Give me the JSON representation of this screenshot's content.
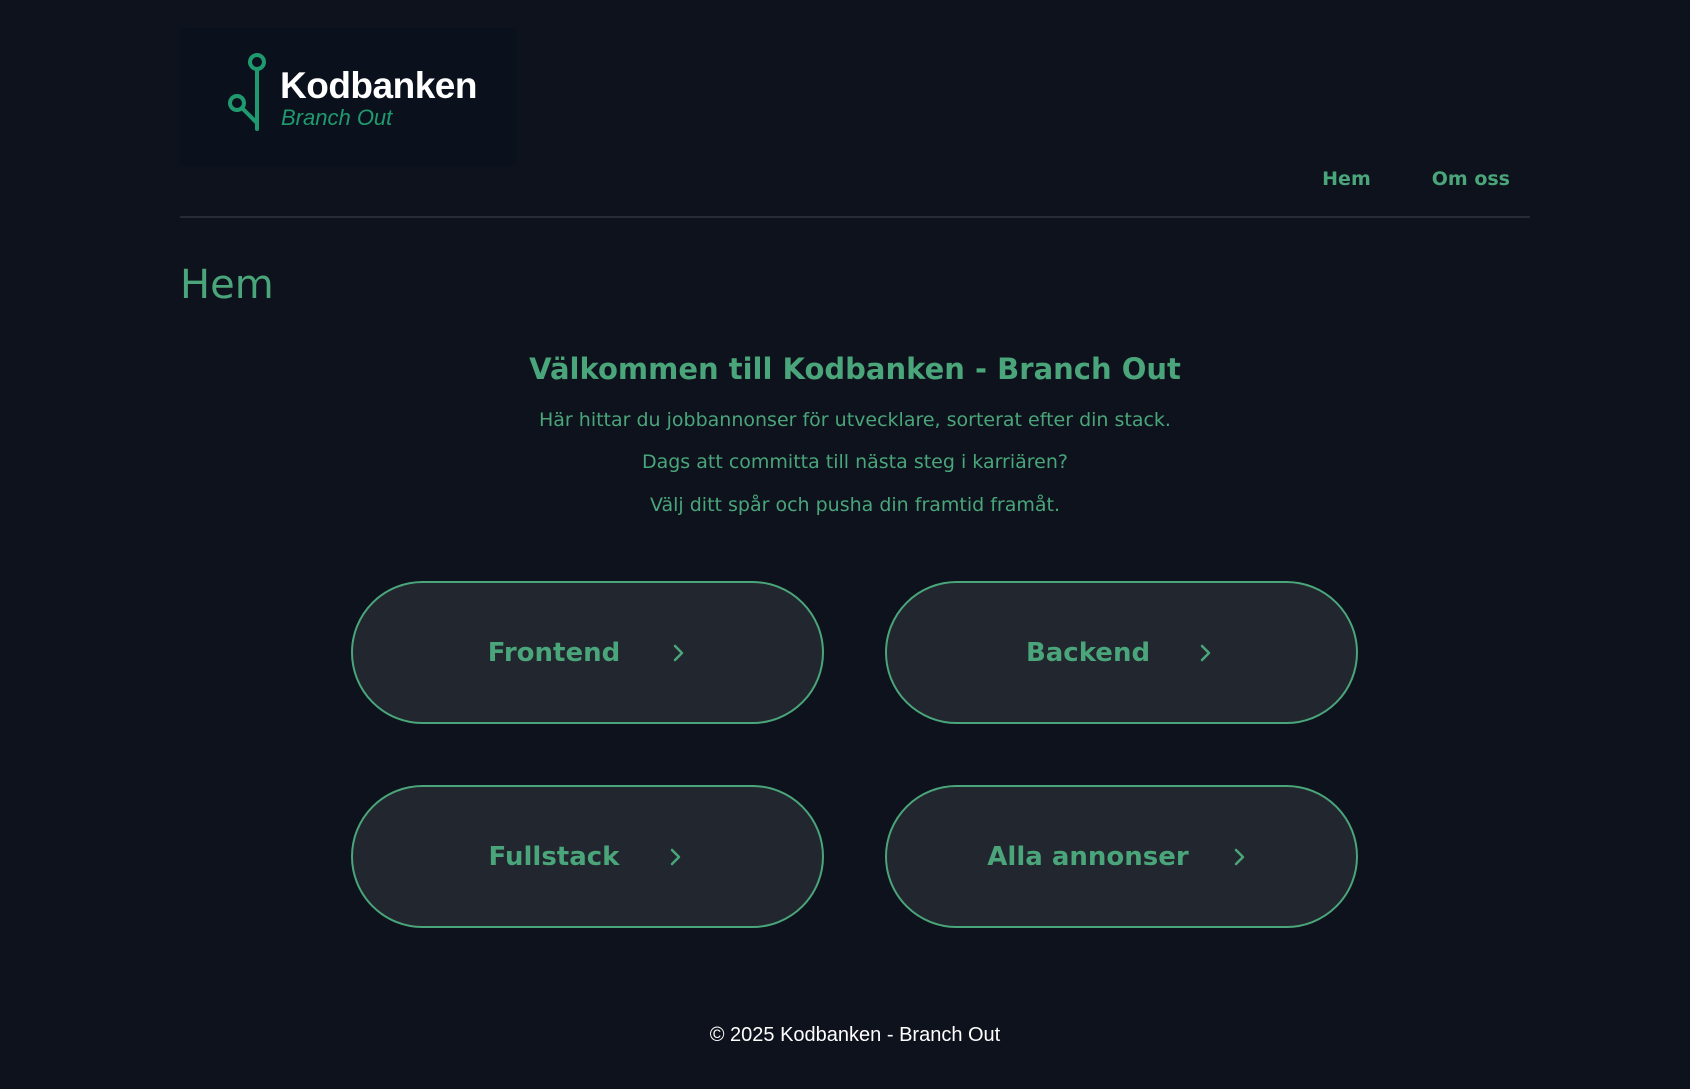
{
  "header": {
    "logo": {
      "title": "Kodbanken",
      "subtitle": "Branch Out"
    },
    "nav": [
      {
        "label": "Hem"
      },
      {
        "label": "Om oss"
      }
    ]
  },
  "main": {
    "page_title": "Hem",
    "welcome_heading": "Välkommen till Kodbanken - Branch Out",
    "intro_lines": [
      "Här hittar du jobbannonser för utvecklare, sorterat efter din stack.",
      "Dags att committa till nästa steg i karriären?",
      "Välj ditt spår och pusha din framtid framåt."
    ],
    "categories": [
      {
        "label": "Frontend",
        "icon": "chevron-right-icon"
      },
      {
        "label": "Backend",
        "icon": "chevron-right-icon"
      },
      {
        "label": "Fullstack",
        "icon": "chevron-right-icon"
      },
      {
        "label": "Alla annonser",
        "icon": "chevron-right-icon"
      }
    ]
  },
  "footer": {
    "copyright": "© 2025 Kodbanken - Branch Out"
  },
  "colors": {
    "background": "#0d121c",
    "accent": "#4aa57a",
    "logo_green": "#1f9a6f",
    "card_fill": "#22262e",
    "text_white": "#ffffff"
  }
}
